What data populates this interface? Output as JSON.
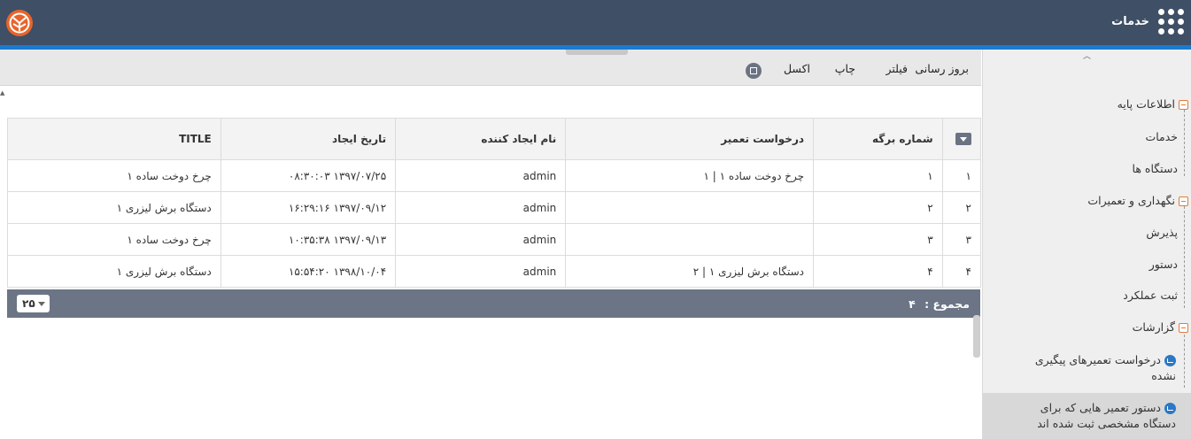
{
  "header": {
    "app_title": "خدمات",
    "logo_icon": "logo-icon",
    "apps_icon": "apps-grid-icon"
  },
  "toolbar": {
    "refresh": "بروز رسانی",
    "filter": "فیلتر",
    "print": "چاپ",
    "excel": "اکسل",
    "extra_icon": "window-icon"
  },
  "grid": {
    "columns": [
      "شماره برگه",
      "درخواست تعمیر",
      "نام ایجاد کننده",
      "تاریخ ایجاد",
      "TITLE"
    ],
    "rows": [
      {
        "idx": "۱",
        "sheet_no": "۱",
        "repair_request": "چرخ دوخت ساده ۱ | ۱",
        "creator": "admin",
        "created": "۱۳۹۷/۰۷/۲۵ ۰۸:۳۰:۰۳",
        "title": "چرخ دوخت ساده ۱"
      },
      {
        "idx": "۲",
        "sheet_no": "۲",
        "repair_request": "",
        "creator": "admin",
        "created": "۱۳۹۷/۰۹/۱۲ ۱۶:۲۹:۱۶",
        "title": "دستگاه برش لیزری ۱"
      },
      {
        "idx": "۳",
        "sheet_no": "۳",
        "repair_request": "",
        "creator": "admin",
        "created": "۱۳۹۷/۰۹/۱۳ ۱۰:۳۵:۳۸",
        "title": "چرخ دوخت ساده ۱"
      },
      {
        "idx": "۴",
        "sheet_no": "۴",
        "repair_request": "دستگاه برش لیزری ۱ | ۲",
        "creator": "admin",
        "created": "۱۳۹۸/۱۰/۰۴ ۱۵:۵۴:۲۰",
        "title": "دستگاه برش لیزری ۱"
      }
    ],
    "footer": {
      "total_label": "مجموع :",
      "total_value": "۴",
      "page_size": "۲۵"
    }
  },
  "sidebar": {
    "groups": [
      {
        "label": "اطلاعات پایه",
        "items": [
          "خدمات",
          "دستگاه ها"
        ]
      },
      {
        "label": "نگهداری و تعمیرات",
        "items": [
          "پذیرش",
          "دستور",
          "ثبت عملکرد"
        ]
      },
      {
        "label": "گزارشات",
        "reports": [
          "درخواست تعمیرهای پیگیری نشده",
          "دستور تعمیر هایی که برای دستگاه مشخصی ثبت شده اند"
        ]
      }
    ]
  },
  "colors": {
    "header_bg": "#3e4f66",
    "accent_line": "#1a7ad0",
    "footer_bg": "#6b7586",
    "group_marker": "#e07b39"
  }
}
